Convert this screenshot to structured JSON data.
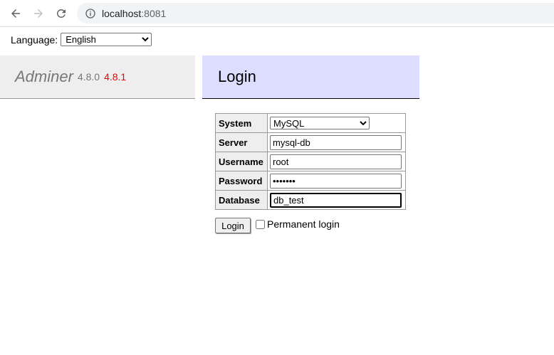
{
  "browser": {
    "url_host": "localhost",
    "url_port": ":8081"
  },
  "language": {
    "label": "Language:",
    "selected": "English"
  },
  "brand": {
    "name": "Adminer",
    "version": "4.8.0",
    "new_version": "4.8.1"
  },
  "login": {
    "title": "Login",
    "fields": {
      "system_label": "System",
      "system_value": "MySQL",
      "server_label": "Server",
      "server_value": "mysql-db",
      "username_label": "Username",
      "username_value": "root",
      "password_label": "Password",
      "password_value": "•••••••",
      "database_label": "Database",
      "database_value": "db_test"
    },
    "submit_label": "Login",
    "permanent_label": "Permanent login",
    "permanent_checked": false
  }
}
